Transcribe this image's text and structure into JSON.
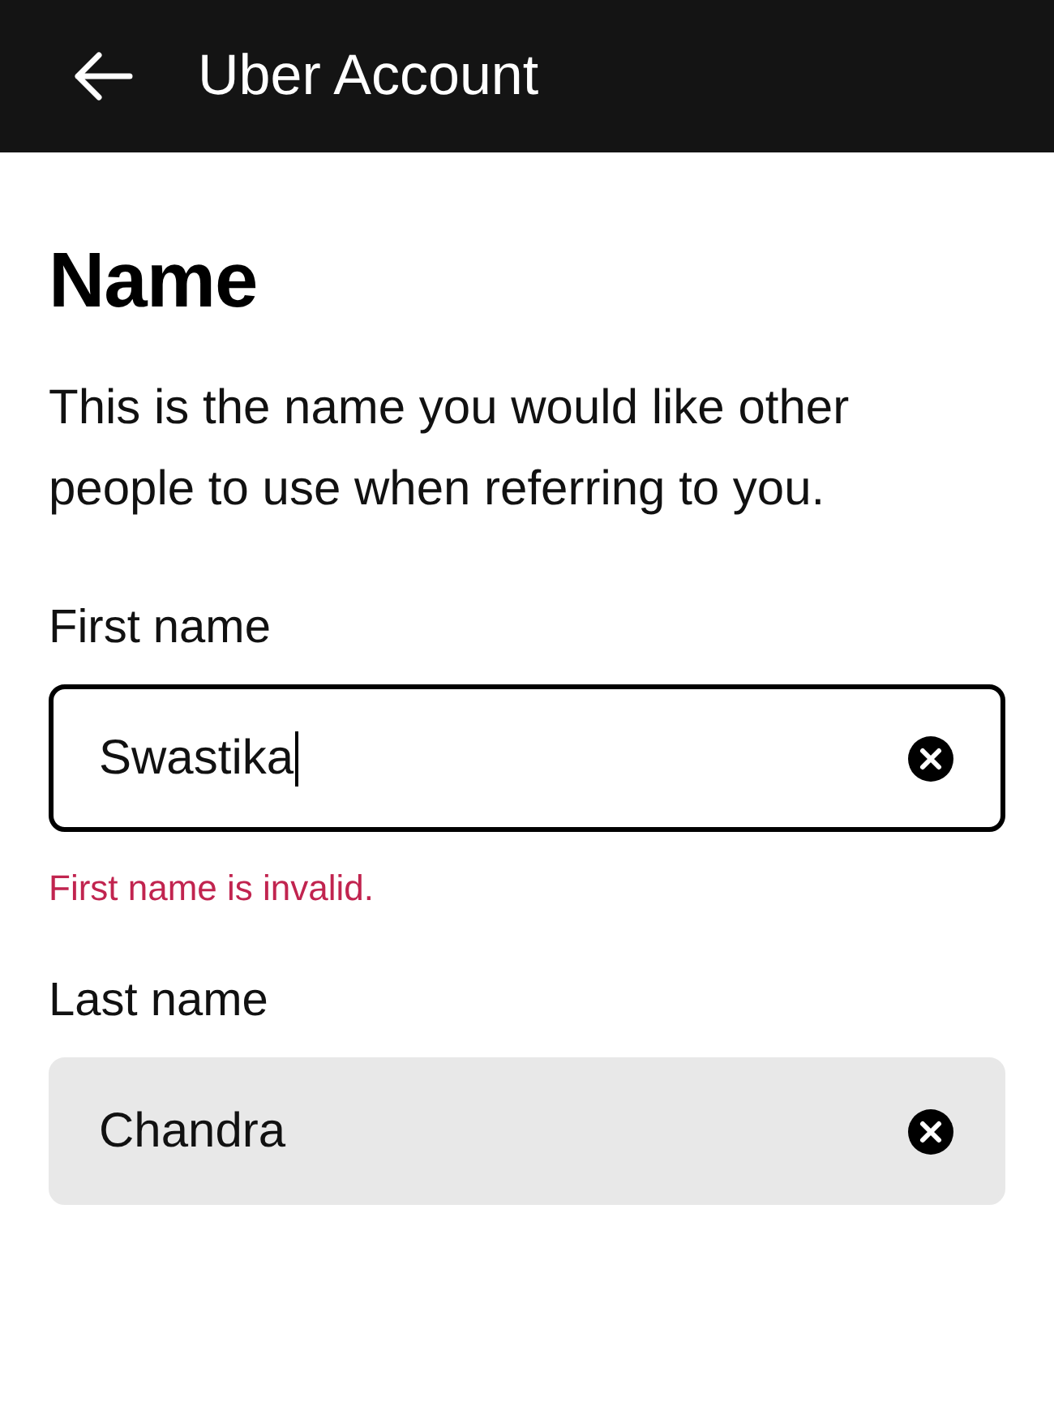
{
  "header": {
    "title": "Uber Account"
  },
  "heading": "Name",
  "description": "This is the name you would like other people to use when referring to you.",
  "fields": [
    {
      "label": "First name",
      "value": "Swastika",
      "focused": true,
      "error": "First name is invalid."
    },
    {
      "label": "Last name",
      "value": "Chandra",
      "focused": false
    }
  ]
}
